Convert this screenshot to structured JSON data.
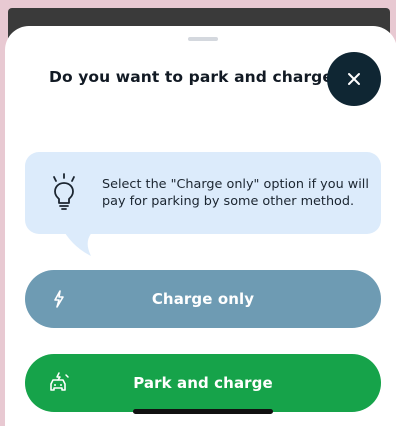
{
  "dialog": {
    "title": "Do you want to park and charge?",
    "close_icon": "close-icon"
  },
  "tip": {
    "icon": "lightbulb-icon",
    "text": "Select the \"Charge only\" option if you will pay for parking by some other method."
  },
  "options": [
    {
      "label": "Charge only",
      "icon": "lightning-bolt-icon",
      "color": "#6e9bb3"
    },
    {
      "label": "Park and charge",
      "icon": "car-charging-icon",
      "color": "#16a34a"
    }
  ],
  "colors": {
    "close_button": "#0f2633",
    "tip_background": "#dcebfb"
  }
}
